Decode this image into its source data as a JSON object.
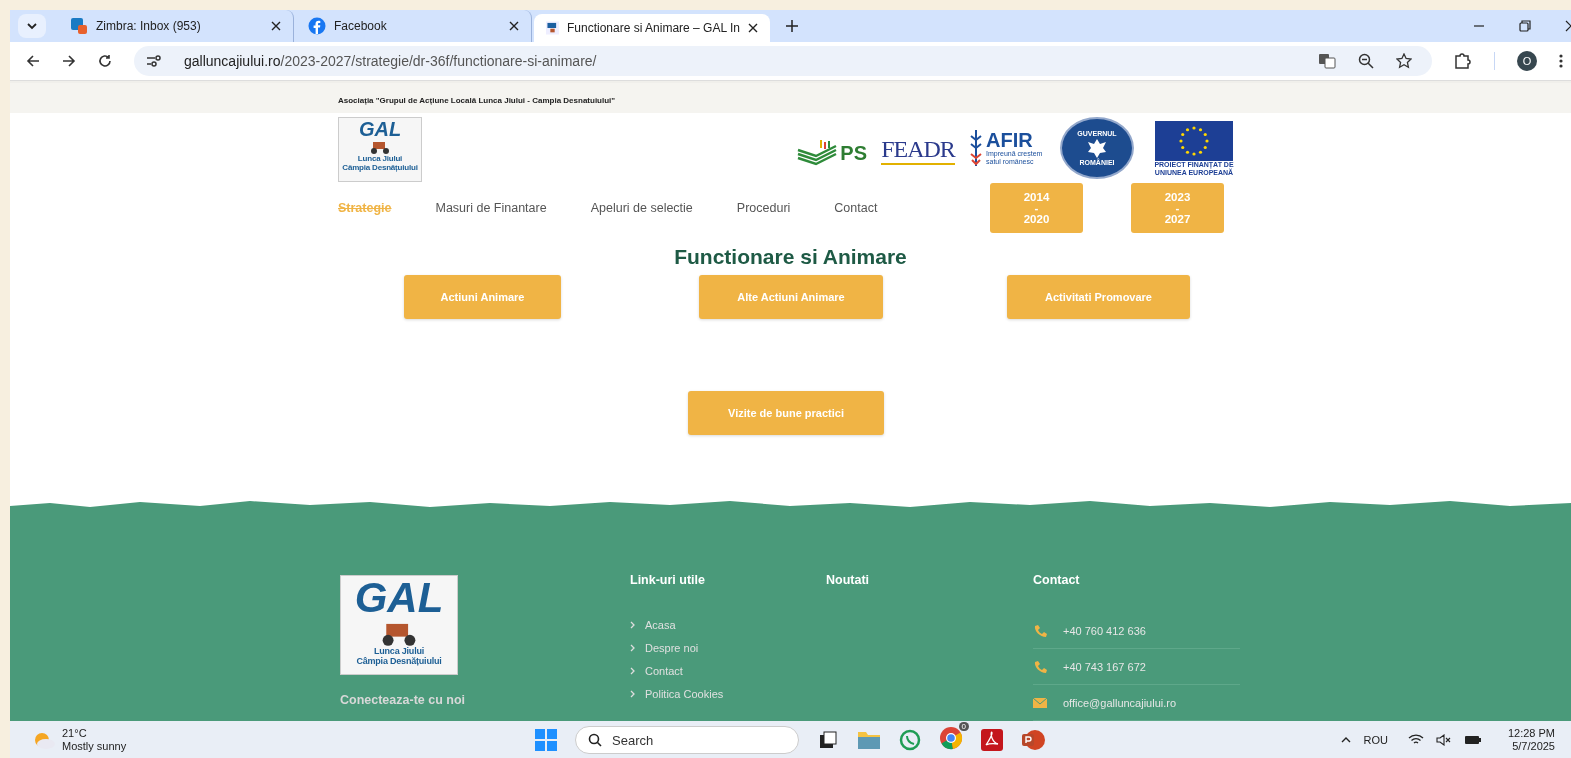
{
  "browser": {
    "tabs": [
      {
        "title": "Zimbra: Inbox (953)",
        "kind": "mail",
        "selected": false
      },
      {
        "title": "Facebook",
        "kind": "social",
        "selected": false
      },
      {
        "title": "Functionare si Animare – GAL In",
        "kind": "site",
        "selected": true
      }
    ],
    "url_host": "galluncajiului.ro",
    "url_path": "/2023-2027/strategie/dr-36f/functionare-si-animare/",
    "profile": "O"
  },
  "page": {
    "top_strip": "Asociația \"Grupul de Acțiune Locală Lunca Jiului - Campia Desnatuiului\"",
    "logo": {
      "title": "GAL",
      "line1": "Lunca Jiului",
      "line2": "Câmpia Desnățuiului"
    },
    "partners": [
      {
        "kind": "ps",
        "title": "PS"
      },
      {
        "kind": "feadr",
        "title": "FEADR"
      },
      {
        "kind": "afir",
        "title": "AFIR",
        "subtitle": "împreună creștem satul românesc"
      },
      {
        "kind": "gov",
        "title": "GUVERNUL",
        "subtitle": "ROMÂNIEI"
      },
      {
        "kind": "eu",
        "title": "PROIECT FINANȚAT DE UNIUNEA EUROPEANĂ"
      }
    ],
    "nav": [
      {
        "label": "Strategie",
        "selected": true
      },
      {
        "label": "Masuri de Finantare",
        "selected": false
      },
      {
        "label": "Apeluri de selectie",
        "selected": false
      },
      {
        "label": "Proceduri",
        "selected": false
      },
      {
        "label": "Contact",
        "selected": false
      }
    ],
    "period_buttons": [
      {
        "start": "2014",
        "sep": "-",
        "end": "2020"
      },
      {
        "start": "2023",
        "sep": "-",
        "end": "2027"
      }
    ],
    "heading": "Functionare si Animare",
    "buttons": [
      "Actiuni Animare",
      "Alte Actiuni Animare",
      "Activitati Promovare"
    ],
    "button_bottom": "Vizite de bune practici",
    "footer": {
      "logo": {
        "title": "GAL",
        "line1": "Lunca Jiului",
        "line2": "Câmpia Desnățuiului"
      },
      "connect": "Conecteaza-te cu noi",
      "links_title": "Link-uri utile",
      "links": [
        "Acasa",
        "Despre noi",
        "Contact",
        "Politica Cookies"
      ],
      "news_title": "Noutati",
      "contact_title": "Contact",
      "contacts": [
        {
          "kind": "phone",
          "text": "+40 760 412 636"
        },
        {
          "kind": "phone",
          "text": "+40 743 167 672"
        },
        {
          "kind": "email",
          "text": "office@galluncajiului.ro"
        }
      ]
    }
  },
  "taskbar": {
    "temperature": "21°C",
    "weather": "Mostly sunny",
    "search": "Search",
    "chrome_badge": "0",
    "language": "ROU",
    "time": "12:28 PM",
    "date": "5/7/2025"
  }
}
